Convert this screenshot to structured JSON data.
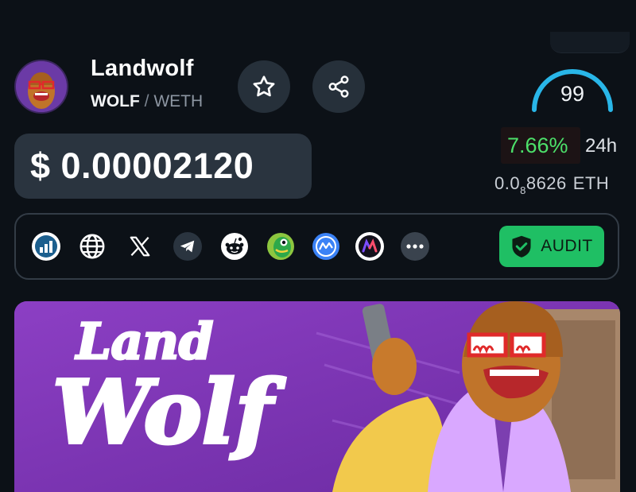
{
  "token": {
    "name": "Landwolf",
    "base_symbol": "WOLF",
    "separator": "/",
    "quote_symbol": "WETH"
  },
  "actions": {
    "favorite_icon": "star-icon",
    "share_icon": "share-icon"
  },
  "price": {
    "usd": "$ 0.00002120",
    "change_24h": "7.66%",
    "change_period": "24h",
    "eth_prefix": "0.0",
    "eth_zero_count": "8",
    "eth_digits": "8626",
    "eth_unit": "ETH"
  },
  "score": {
    "value": "99",
    "max": 100,
    "color": "#29b6e8"
  },
  "links": [
    {
      "name": "dextools-icon"
    },
    {
      "name": "website-globe-icon"
    },
    {
      "name": "x-twitter-icon"
    },
    {
      "name": "telegram-icon"
    },
    {
      "name": "reddit-icon"
    },
    {
      "name": "coingecko-icon"
    },
    {
      "name": "coinmarketcap-icon"
    },
    {
      "name": "app-m-icon"
    },
    {
      "name": "more-icon"
    }
  ],
  "audit": {
    "label": "AUDIT",
    "icon": "shield-check-icon",
    "color": "#1fbf64"
  },
  "banner": {
    "logo_text_line1": "Land",
    "logo_text_line2": "Wolf",
    "background": "#7c36b2"
  },
  "colors": {
    "background": "#0c1117",
    "positive": "#4ce06a",
    "panel": "#2a343f"
  }
}
